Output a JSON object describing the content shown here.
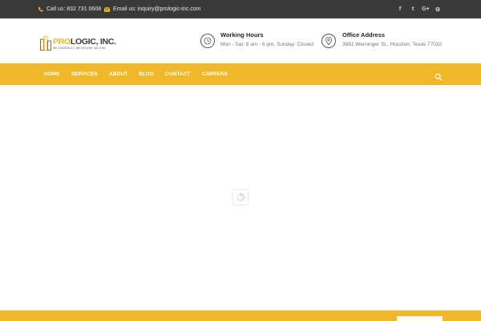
{
  "topbar": {
    "phone": "Call us: 832 731 0608",
    "email": "Email us: inquiry@prologic-inc.com",
    "social": [
      {
        "icon": "facebook-icon",
        "glyph": "f"
      },
      {
        "icon": "twitter-icon",
        "glyph": "t"
      },
      {
        "icon": "google-plus-icon",
        "glyph": "G+"
      },
      {
        "icon": "github-icon",
        "glyph": "⚙"
      }
    ]
  },
  "logo": {
    "brand_accent": "PRO",
    "brand_main": "LOGIC, INC.",
    "tagline": "WE CONSTRUCT. WE DELIVER. WE STAY."
  },
  "header": {
    "hours_title": "Working Hours",
    "hours_text": "Mon - Sat: 8 am - 6 pm, Sunday: Closed",
    "address_title": "Office Address",
    "address_text": "3681 Werninger St., Houston, Texas 77032"
  },
  "nav": {
    "items": [
      "HOME",
      "SERVICES",
      "ABOUT",
      "BLOG",
      "CONTACT",
      "CAREERS"
    ]
  },
  "colors": {
    "accent": "#f0b828",
    "topbar_bg": "#3a3a3a"
  }
}
